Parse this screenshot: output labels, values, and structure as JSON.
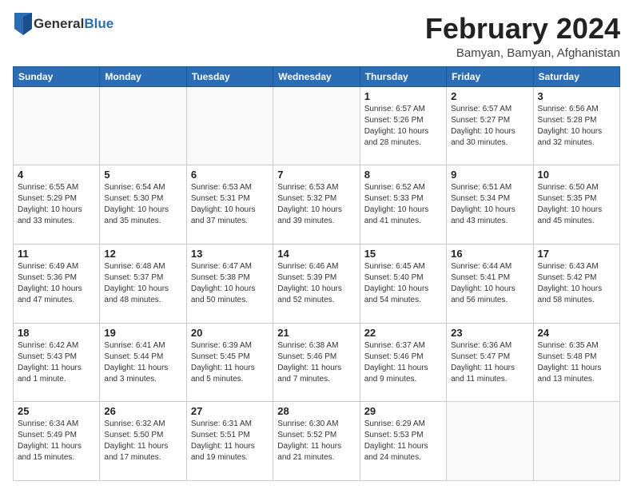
{
  "header": {
    "logo_general": "General",
    "logo_blue": "Blue",
    "month_title": "February 2024",
    "location": "Bamyan, Bamyan, Afghanistan"
  },
  "days_of_week": [
    "Sunday",
    "Monday",
    "Tuesday",
    "Wednesday",
    "Thursday",
    "Friday",
    "Saturday"
  ],
  "weeks": [
    [
      {
        "day": "",
        "info": ""
      },
      {
        "day": "",
        "info": ""
      },
      {
        "day": "",
        "info": ""
      },
      {
        "day": "",
        "info": ""
      },
      {
        "day": "1",
        "info": "Sunrise: 6:57 AM\nSunset: 5:26 PM\nDaylight: 10 hours\nand 28 minutes."
      },
      {
        "day": "2",
        "info": "Sunrise: 6:57 AM\nSunset: 5:27 PM\nDaylight: 10 hours\nand 30 minutes."
      },
      {
        "day": "3",
        "info": "Sunrise: 6:56 AM\nSunset: 5:28 PM\nDaylight: 10 hours\nand 32 minutes."
      }
    ],
    [
      {
        "day": "4",
        "info": "Sunrise: 6:55 AM\nSunset: 5:29 PM\nDaylight: 10 hours\nand 33 minutes."
      },
      {
        "day": "5",
        "info": "Sunrise: 6:54 AM\nSunset: 5:30 PM\nDaylight: 10 hours\nand 35 minutes."
      },
      {
        "day": "6",
        "info": "Sunrise: 6:53 AM\nSunset: 5:31 PM\nDaylight: 10 hours\nand 37 minutes."
      },
      {
        "day": "7",
        "info": "Sunrise: 6:53 AM\nSunset: 5:32 PM\nDaylight: 10 hours\nand 39 minutes."
      },
      {
        "day": "8",
        "info": "Sunrise: 6:52 AM\nSunset: 5:33 PM\nDaylight: 10 hours\nand 41 minutes."
      },
      {
        "day": "9",
        "info": "Sunrise: 6:51 AM\nSunset: 5:34 PM\nDaylight: 10 hours\nand 43 minutes."
      },
      {
        "day": "10",
        "info": "Sunrise: 6:50 AM\nSunset: 5:35 PM\nDaylight: 10 hours\nand 45 minutes."
      }
    ],
    [
      {
        "day": "11",
        "info": "Sunrise: 6:49 AM\nSunset: 5:36 PM\nDaylight: 10 hours\nand 47 minutes."
      },
      {
        "day": "12",
        "info": "Sunrise: 6:48 AM\nSunset: 5:37 PM\nDaylight: 10 hours\nand 48 minutes."
      },
      {
        "day": "13",
        "info": "Sunrise: 6:47 AM\nSunset: 5:38 PM\nDaylight: 10 hours\nand 50 minutes."
      },
      {
        "day": "14",
        "info": "Sunrise: 6:46 AM\nSunset: 5:39 PM\nDaylight: 10 hours\nand 52 minutes."
      },
      {
        "day": "15",
        "info": "Sunrise: 6:45 AM\nSunset: 5:40 PM\nDaylight: 10 hours\nand 54 minutes."
      },
      {
        "day": "16",
        "info": "Sunrise: 6:44 AM\nSunset: 5:41 PM\nDaylight: 10 hours\nand 56 minutes."
      },
      {
        "day": "17",
        "info": "Sunrise: 6:43 AM\nSunset: 5:42 PM\nDaylight: 10 hours\nand 58 minutes."
      }
    ],
    [
      {
        "day": "18",
        "info": "Sunrise: 6:42 AM\nSunset: 5:43 PM\nDaylight: 11 hours\nand 1 minute."
      },
      {
        "day": "19",
        "info": "Sunrise: 6:41 AM\nSunset: 5:44 PM\nDaylight: 11 hours\nand 3 minutes."
      },
      {
        "day": "20",
        "info": "Sunrise: 6:39 AM\nSunset: 5:45 PM\nDaylight: 11 hours\nand 5 minutes."
      },
      {
        "day": "21",
        "info": "Sunrise: 6:38 AM\nSunset: 5:46 PM\nDaylight: 11 hours\nand 7 minutes."
      },
      {
        "day": "22",
        "info": "Sunrise: 6:37 AM\nSunset: 5:46 PM\nDaylight: 11 hours\nand 9 minutes."
      },
      {
        "day": "23",
        "info": "Sunrise: 6:36 AM\nSunset: 5:47 PM\nDaylight: 11 hours\nand 11 minutes."
      },
      {
        "day": "24",
        "info": "Sunrise: 6:35 AM\nSunset: 5:48 PM\nDaylight: 11 hours\nand 13 minutes."
      }
    ],
    [
      {
        "day": "25",
        "info": "Sunrise: 6:34 AM\nSunset: 5:49 PM\nDaylight: 11 hours\nand 15 minutes."
      },
      {
        "day": "26",
        "info": "Sunrise: 6:32 AM\nSunset: 5:50 PM\nDaylight: 11 hours\nand 17 minutes."
      },
      {
        "day": "27",
        "info": "Sunrise: 6:31 AM\nSunset: 5:51 PM\nDaylight: 11 hours\nand 19 minutes."
      },
      {
        "day": "28",
        "info": "Sunrise: 6:30 AM\nSunset: 5:52 PM\nDaylight: 11 hours\nand 21 minutes."
      },
      {
        "day": "29",
        "info": "Sunrise: 6:29 AM\nSunset: 5:53 PM\nDaylight: 11 hours\nand 24 minutes."
      },
      {
        "day": "",
        "info": ""
      },
      {
        "day": "",
        "info": ""
      }
    ]
  ]
}
